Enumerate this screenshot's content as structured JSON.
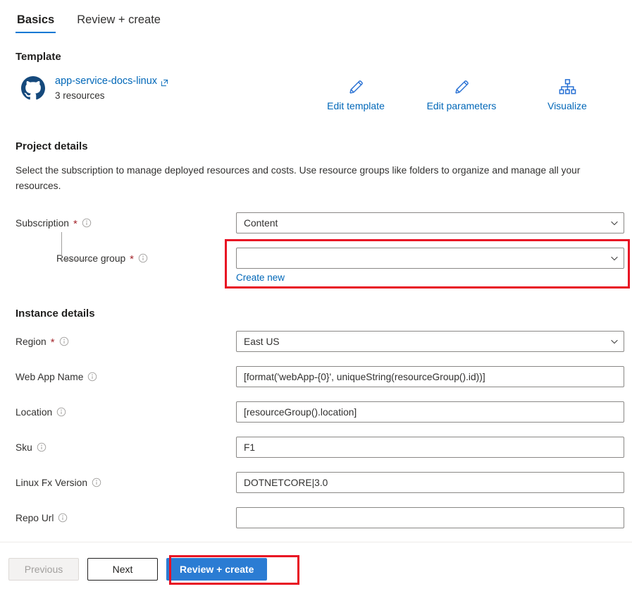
{
  "tabs": [
    {
      "label": "Basics",
      "active": true
    },
    {
      "label": "Review + create",
      "active": false
    }
  ],
  "template": {
    "heading": "Template",
    "link_text": "app-service-docs-linux",
    "subtitle": "3 resources",
    "actions": [
      {
        "label": "Edit template",
        "icon": "pencil-icon"
      },
      {
        "label": "Edit parameters",
        "icon": "pencil-icon"
      },
      {
        "label": "Visualize",
        "icon": "hierarchy-icon"
      }
    ]
  },
  "project_details": {
    "heading": "Project details",
    "description": "Select the subscription to manage deployed resources and costs. Use resource groups like folders to organize and manage all your resources.",
    "subscription": {
      "label": "Subscription",
      "required": "*",
      "value": "Content"
    },
    "resource_group": {
      "label": "Resource group",
      "required": "*",
      "value": "",
      "create_new": "Create new"
    }
  },
  "instance_details": {
    "heading": "Instance details",
    "fields": [
      {
        "label": "Region",
        "required": "*",
        "value": "East US",
        "type": "select"
      },
      {
        "label": "Web App Name",
        "required": "",
        "value": "[format('webApp-{0}', uniqueString(resourceGroup().id))]",
        "type": "text"
      },
      {
        "label": "Location",
        "required": "",
        "value": "[resourceGroup().location]",
        "type": "text"
      },
      {
        "label": "Sku",
        "required": "",
        "value": "F1",
        "type": "text"
      },
      {
        "label": "Linux Fx Version",
        "required": "",
        "value": "DOTNETCORE|3.0",
        "type": "text"
      },
      {
        "label": "Repo Url",
        "required": "",
        "value": "",
        "type": "text"
      }
    ]
  },
  "footer": {
    "previous": "Previous",
    "next": "Next",
    "review_create": "Review + create"
  },
  "colors": {
    "accent": "#0078d4",
    "link": "#0067b8",
    "primary_button": "#2b7cd3",
    "highlight": "#e81123",
    "required": "#a4262c"
  }
}
